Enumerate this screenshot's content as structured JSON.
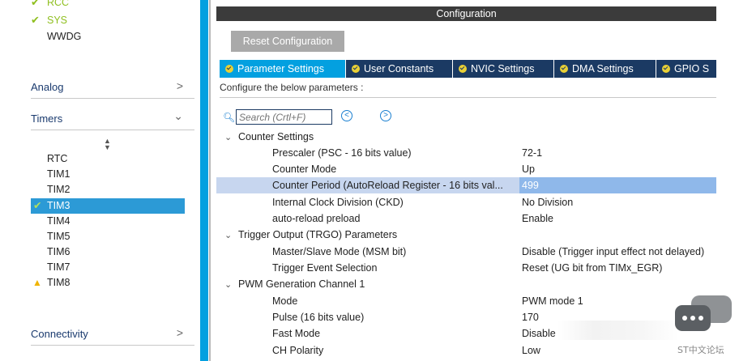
{
  "sidebar": {
    "system_items": [
      {
        "label": "RCC",
        "checked": true
      },
      {
        "label": "SYS",
        "checked": true
      },
      {
        "label": "WWDG",
        "checked": false
      }
    ],
    "categories": {
      "analog": {
        "label": "Analog",
        "arrow": ">"
      },
      "timers": {
        "label": "Timers",
        "arrow": "⌄"
      },
      "connectivity": {
        "label": "Connectivity",
        "arrow": ">"
      }
    },
    "timers": [
      {
        "label": "RTC",
        "status": "none"
      },
      {
        "label": "TIM1",
        "status": "none"
      },
      {
        "label": "TIM2",
        "status": "none"
      },
      {
        "label": "TIM3",
        "status": "checked-selected"
      },
      {
        "label": "TIM4",
        "status": "none"
      },
      {
        "label": "TIM5",
        "status": "none"
      },
      {
        "label": "TIM6",
        "status": "none"
      },
      {
        "label": "TIM7",
        "status": "none"
      },
      {
        "label": "TIM8",
        "status": "warning"
      }
    ]
  },
  "main": {
    "header_title": "Configuration",
    "reset_button": "Reset Configuration",
    "tabs": [
      {
        "label": "Parameter Settings",
        "active": true
      },
      {
        "label": "User Constants",
        "active": false
      },
      {
        "label": "NVIC Settings",
        "active": false
      },
      {
        "label": "DMA Settings",
        "active": false
      },
      {
        "label": "GPIO S",
        "active": false
      }
    ],
    "configure_text": "Configure the below parameters :",
    "search_placeholder": "Search (Crtl+F)",
    "groups": [
      {
        "label": "Counter Settings",
        "params": [
          {
            "name": "Prescaler (PSC - 16 bits value)",
            "value": "72-1"
          },
          {
            "name": "Counter Mode",
            "value": "Up"
          },
          {
            "name": "Counter Period (AutoReload Register - 16 bits val...",
            "value": "499",
            "selected": true
          },
          {
            "name": "Internal Clock Division (CKD)",
            "value": "No Division"
          },
          {
            "name": "auto-reload preload",
            "value": "Enable"
          }
        ]
      },
      {
        "label": "Trigger Output (TRGO) Parameters",
        "params": [
          {
            "name": "Master/Slave Mode (MSM bit)",
            "value": "Disable (Trigger input effect not delayed)"
          },
          {
            "name": "Trigger Event Selection",
            "value": "Reset (UG bit from TIMx_EGR)"
          }
        ]
      },
      {
        "label": "PWM Generation Channel 1",
        "params": [
          {
            "name": "Mode",
            "value": "PWM mode 1"
          },
          {
            "name": "Pulse (16 bits value)",
            "value": "170"
          },
          {
            "name": "Fast Mode",
            "value": "Disable"
          },
          {
            "name": "CH Polarity",
            "value": "Low"
          }
        ]
      }
    ]
  },
  "watermark": {
    "text": "ST中文论坛"
  },
  "colors": {
    "accent_blue": "#03a0e0",
    "tab_bar_navy": "#1b3a63",
    "check_green": "#8fbf1f",
    "warning_yellow": "#f0b400",
    "selected_row": "#c7d6ef",
    "selected_value": "#8fb8ea"
  }
}
